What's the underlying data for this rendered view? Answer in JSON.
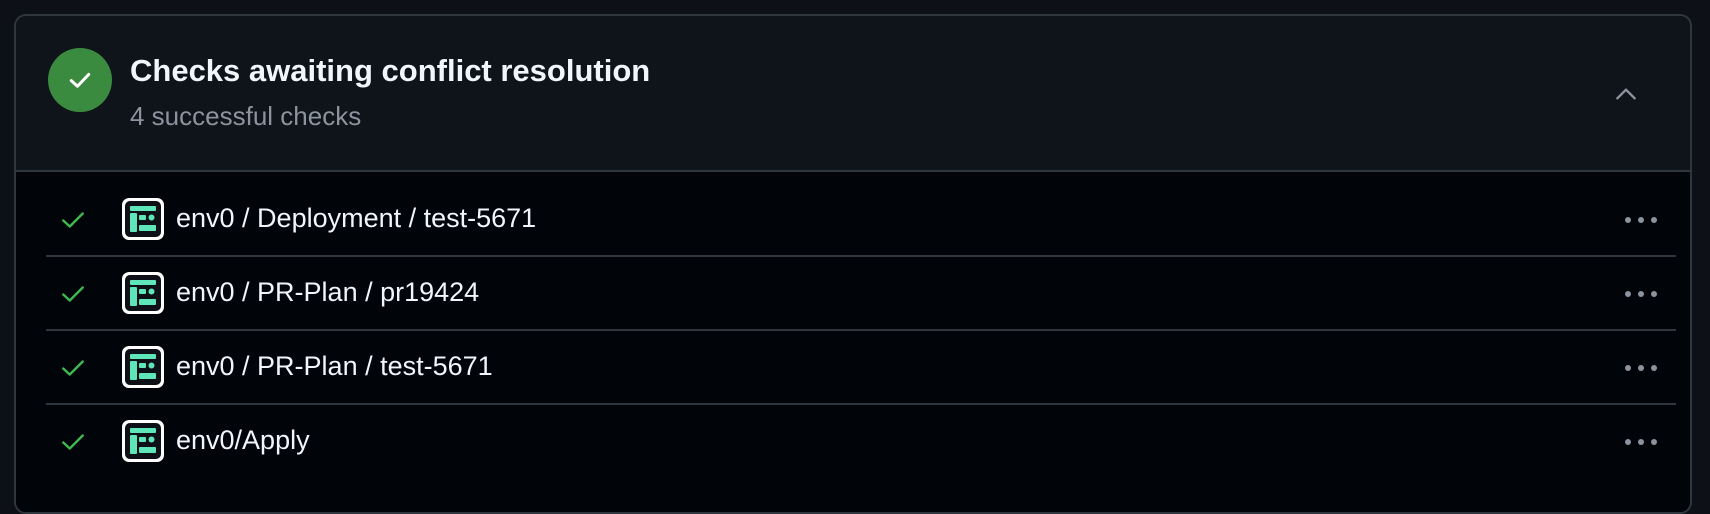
{
  "header": {
    "title": "Checks awaiting conflict resolution",
    "subtitle": "4 successful checks",
    "status_icon": "check-circle-icon",
    "collapse_icon": "chevron-up-icon"
  },
  "checks": [
    {
      "label": "env0 / Deployment / test-5671",
      "status": "success"
    },
    {
      "label": "env0 / PR-Plan / pr19424",
      "status": "success"
    },
    {
      "label": "env0 / PR-Plan / test-5671",
      "status": "success"
    },
    {
      "label": "env0/Apply",
      "status": "success"
    }
  ],
  "colors": {
    "success": "#3fb950",
    "status_circle": "#3a8a3f",
    "app_icon": "#5ee6b8"
  }
}
